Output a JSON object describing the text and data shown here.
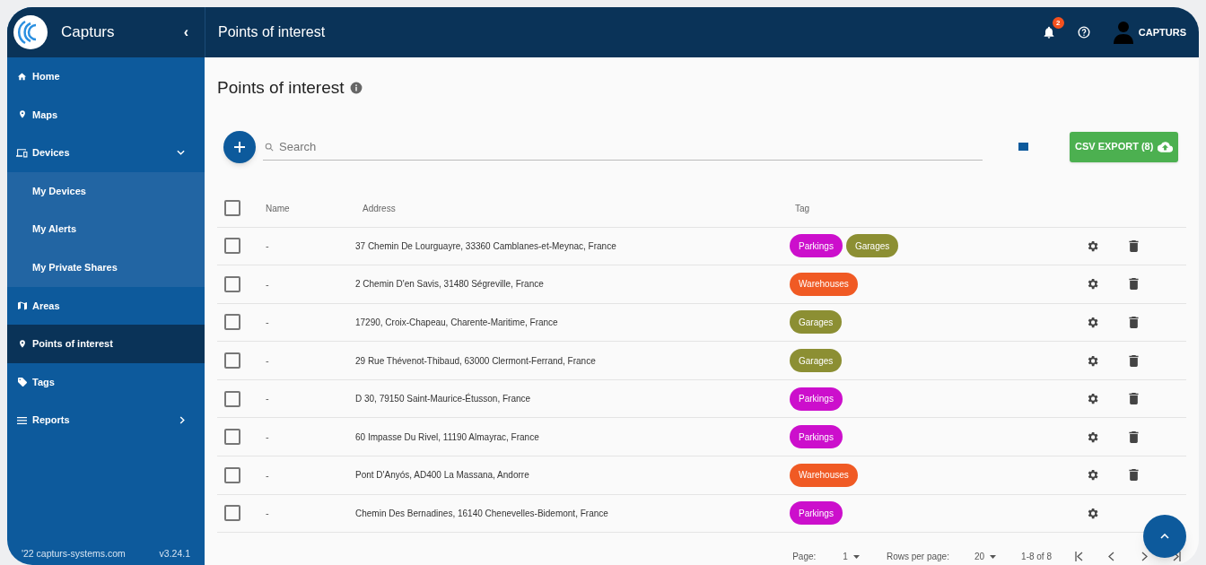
{
  "sidebar": {
    "brand": "Capturs",
    "collapse_icon": "‹",
    "items": [
      {
        "label": "Home",
        "selected": false
      },
      {
        "label": "Maps",
        "selected": false
      },
      {
        "label": "Devices",
        "selected": false,
        "expanded": true,
        "children": [
          {
            "label": "My Devices",
            "selected": false
          },
          {
            "label": "My Alerts",
            "selected": false
          },
          {
            "label": "My Private Shares",
            "selected": false
          }
        ]
      },
      {
        "label": "Areas",
        "selected": false
      },
      {
        "label": "Points of interest",
        "selected": true
      },
      {
        "label": "Tags",
        "selected": false
      },
      {
        "label": "Reports",
        "selected": false,
        "expanded": false
      }
    ],
    "footer": {
      "site": "'22 capturs-systems.com",
      "version": "v3.24.1"
    }
  },
  "header": {
    "title": "Points of interest",
    "notifications": "2",
    "user": "CAPTURS"
  },
  "page": {
    "title": "Points of interest",
    "search": {
      "placeholder": "Search"
    },
    "export_button": "CSV EXPORT (8)"
  },
  "table": {
    "all_selected": false,
    "columns": [
      "Name",
      "Address",
      "Tag"
    ],
    "rows": [
      {
        "name": "-",
        "address": "37 Chemin De Lourguayre, 33360 Camblanes-et-Meynac, France",
        "selected": false,
        "tags": [
          {
            "label": "Parkings",
            "color": "#cc0fcc"
          },
          {
            "label": "Garages",
            "color": "#8c8f33"
          }
        ]
      },
      {
        "name": "-",
        "address": "2 Chemin D'en Savis, 31480 Ségreville, France",
        "selected": false,
        "tags": [
          {
            "label": "Warehouses",
            "color": "#f05a24"
          }
        ]
      },
      {
        "name": "-",
        "address": "17290, Croix-Chapeau, Charente-Maritime, France",
        "selected": false,
        "tags": [
          {
            "label": "Garages",
            "color": "#8c8f33"
          }
        ]
      },
      {
        "name": "-",
        "address": "29 Rue Thévenot-Thibaud, 63000 Clermont-Ferrand, France",
        "selected": false,
        "tags": [
          {
            "label": "Garages",
            "color": "#8c8f33"
          }
        ]
      },
      {
        "name": "-",
        "address": "D 30, 79150 Saint-Maurice-Étusson, France",
        "selected": false,
        "tags": [
          {
            "label": "Parkings",
            "color": "#cc0fcc"
          }
        ]
      },
      {
        "name": "-",
        "address": "60 Impasse Du Rivel, 11190 Almayrac, France",
        "selected": false,
        "tags": [
          {
            "label": "Parkings",
            "color": "#cc0fcc"
          }
        ]
      },
      {
        "name": "-",
        "address": "Pont D'Anyós, AD400 La Massana, Andorre",
        "selected": false,
        "tags": [
          {
            "label": "Warehouses",
            "color": "#f05a24"
          }
        ]
      },
      {
        "name": "-",
        "address": "Chemin Des Bernadines, 16140 Chenevelles-Bidemont, France",
        "selected": false,
        "tags": [
          {
            "label": "Parkings",
            "color": "#cc0fcc"
          }
        ]
      }
    ]
  },
  "pagination": {
    "page_label": "Page:",
    "page": "1",
    "rows_label": "Rows per page:",
    "rows_per_page": "20",
    "range": "1-8 of 8"
  }
}
